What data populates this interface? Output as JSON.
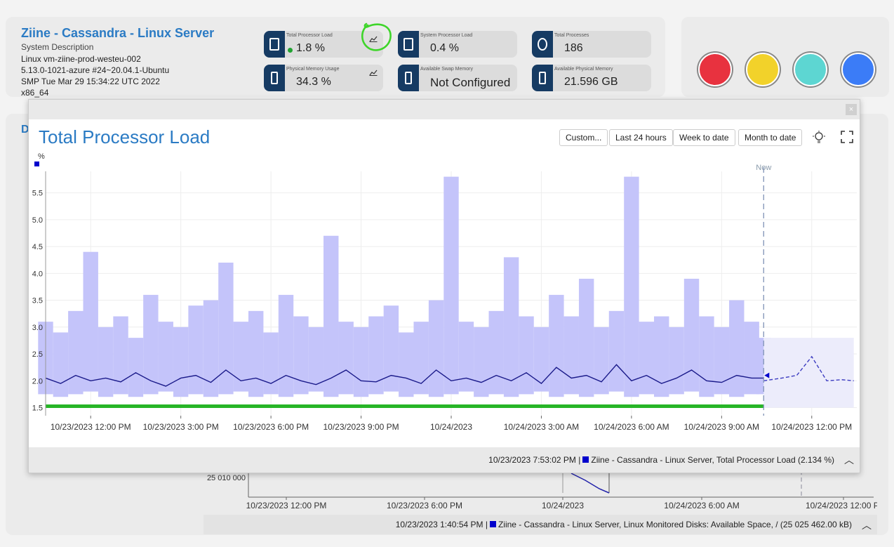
{
  "server": {
    "title": "Ziine - Cassandra - Linux Server",
    "desc_label": "System Description",
    "lines": [
      "Linux vm-ziine-prod-westeu-002",
      "5.13.0-1021-azure #24~20.04.1-Ubuntu",
      "SMP Tue Mar 29 15:34:22 UTC 2022",
      "x86_64"
    ]
  },
  "tiles": [
    {
      "label": "Total Processor Load",
      "value": "1.8 %",
      "icon": "cpu-icon",
      "status": "ok",
      "trend": true
    },
    {
      "label": "System Processor Load",
      "value": "0.4 %",
      "icon": "cpu-icon",
      "trend": false
    },
    {
      "label": "Total Processes",
      "value": "186",
      "icon": "gears-icon",
      "trend": false
    },
    {
      "label": "Physical Memory Usage",
      "value": "34.3 %",
      "icon": "memory-icon",
      "trend": true
    },
    {
      "label": "Available Swap Memory",
      "value": "Not Configured",
      "icon": "memory-icon",
      "trend": false
    },
    {
      "label": "Available Physical Memory",
      "value": "21.596 GB",
      "icon": "memory-icon",
      "trend": false
    }
  ],
  "status_lights": [
    "#e8323f",
    "#f2d22a",
    "#5dd6d2",
    "#3b7cf7"
  ],
  "popup": {
    "title": "Total Processor Load",
    "close": "×",
    "buttons": [
      "Custom...",
      "Last 24 hours",
      "Week to date",
      "Month to date"
    ],
    "unit": "%",
    "now_label": "Now",
    "footer": "10/23/2023 7:53:02 PM |",
    "footer_series": "Ziine - Cassandra - Linux Server, Total Processor Load (2.134 %)"
  },
  "chart_data": {
    "type": "line",
    "ylabel": "%",
    "y_ticks": [
      "1.5",
      "2.0",
      "2.5",
      "3.0",
      "3.5",
      "4.0",
      "4.5",
      "5.0",
      "5.5"
    ],
    "ylim": [
      1.35,
      5.9
    ],
    "x_ticks": [
      "10/23/2023 12:00 PM",
      "10/23/2023 3:00 PM",
      "10/23/2023 6:00 PM",
      "10/23/2023 9:00 PM",
      "10/24/2023",
      "10/24/2023 3:00 AM",
      "10/24/2023 6:00 AM",
      "10/24/2023 9:00 AM",
      "10/24/2023 12:00 PM"
    ],
    "x_tick_hours": [
      12,
      15,
      18,
      21,
      24,
      27,
      30,
      33,
      36
    ],
    "xlim_hours": [
      10.5,
      37.5
    ],
    "now_hour": 34.4,
    "series": [
      {
        "name": "Ziine - Cassandra - Linux Server, Total Processor Load",
        "color": "#1a1a8a",
        "x_hours": [
          10.5,
          11,
          11.5,
          12,
          12.5,
          13,
          13.5,
          14,
          14.5,
          15,
          15.5,
          16,
          16.5,
          17,
          17.5,
          18,
          18.5,
          19,
          19.5,
          20,
          20.5,
          21,
          21.5,
          22,
          22.5,
          23,
          23.5,
          24,
          24.5,
          25,
          25.5,
          26,
          26.5,
          27,
          27.5,
          28,
          28.5,
          29,
          29.5,
          30,
          30.5,
          31,
          31.5,
          32,
          32.5,
          33,
          33.5,
          34,
          34.4
        ],
        "values": [
          2.05,
          1.95,
          2.1,
          2.0,
          2.05,
          1.98,
          2.15,
          2.0,
          1.9,
          2.05,
          2.1,
          1.97,
          2.2,
          2.0,
          2.05,
          1.95,
          2.1,
          2.0,
          1.93,
          2.05,
          2.2,
          2.0,
          1.98,
          2.1,
          2.05,
          1.95,
          2.2,
          2.0,
          2.05,
          1.97,
          2.1,
          2.0,
          2.15,
          1.95,
          2.25,
          2.05,
          2.1,
          1.98,
          2.3,
          2.0,
          2.1,
          1.95,
          2.05,
          2.2,
          2.0,
          1.97,
          2.1,
          2.05,
          2.05
        ]
      },
      {
        "name": "Forecast",
        "color": "#3c3cc0",
        "x_hours": [
          34.4,
          35,
          35.5,
          36,
          36.5,
          37,
          37.4
        ],
        "values": [
          2.0,
          2.05,
          2.1,
          2.45,
          2.0,
          2.02,
          2.0
        ]
      }
    ],
    "band": {
      "upper": [
        3.1,
        2.9,
        3.3,
        4.4,
        3.0,
        3.2,
        2.8,
        3.6,
        3.1,
        3.0,
        3.4,
        3.5,
        4.2,
        3.1,
        3.3,
        2.9,
        3.6,
        3.2,
        3.0,
        4.7,
        3.1,
        3.0,
        3.2,
        3.4,
        2.9,
        3.1,
        3.5,
        5.8,
        3.1,
        3.0,
        3.3,
        4.3,
        3.2,
        3.0,
        3.6,
        3.2,
        3.9,
        3.0,
        3.3,
        5.8,
        3.1,
        3.2,
        3.0,
        3.9,
        3.2,
        3.0,
        3.5,
        3.1,
        2.8
      ],
      "lower": [
        1.75,
        1.7,
        1.75,
        1.8,
        1.7,
        1.75,
        1.7,
        1.75,
        1.8,
        1.7,
        1.75,
        1.7,
        1.75,
        1.8,
        1.7,
        1.75,
        1.7,
        1.75,
        1.8,
        1.7,
        1.75,
        1.7,
        1.75,
        1.8,
        1.7,
        1.75,
        1.7,
        1.75,
        1.8,
        1.7,
        1.75,
        1.7,
        1.75,
        1.8,
        1.7,
        1.75,
        1.7,
        1.75,
        1.8,
        1.7,
        1.75,
        1.7,
        1.75,
        1.8,
        1.7,
        1.75,
        1.7,
        1.75,
        1.75
      ]
    },
    "grid": true,
    "legend": "bottom"
  },
  "bg_chart": {
    "y_tick": "25 010 000",
    "x_ticks": [
      "10/23/2023 12:00 PM",
      "10/23/2023 6:00 PM",
      "10/24/2023",
      "10/24/2023 6:00 AM",
      "10/24/2023 12:00 PI"
    ],
    "footer": "10/23/2023 1:40:54 PM |",
    "footer_series": "Ziine - Cassandra - Linux Server, Linux Monitored Disks: Available Space, / (25 025 462.00 kB)"
  },
  "bg_title_letter": "D"
}
